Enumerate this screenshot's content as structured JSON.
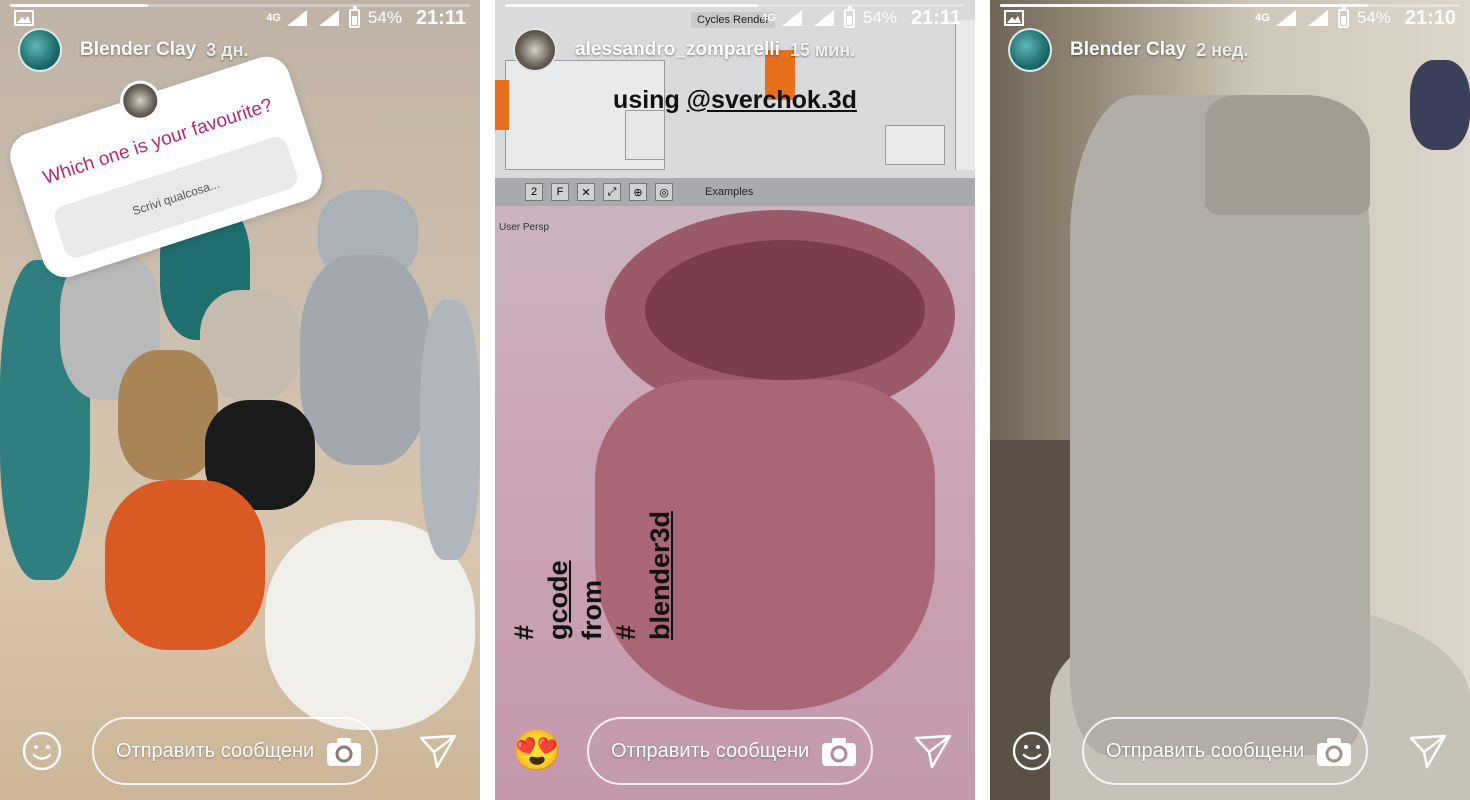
{
  "status_bar": [
    {
      "network": "4G",
      "battery": "54%",
      "time": "21:11"
    },
    {
      "network": "4G",
      "battery": "54%",
      "time": "21:11"
    },
    {
      "network": "4G",
      "battery": "54%",
      "time": "21:10"
    }
  ],
  "stories": [
    {
      "username": "Blender Clay",
      "time_ago": "3 дн.",
      "question_sticker": {
        "question": "Which one is your favourite?",
        "input_placeholder": "Scrivi qualcosa..."
      }
    },
    {
      "username": "alessandro_zomparelli",
      "time_ago": "15 мин.",
      "overlay_text_top_prefix": "using ",
      "overlay_text_top_mention": "@sverchok.3d",
      "overlay_text_vertical_line1_prefix": "#",
      "overlay_text_vertical_line1_tag": "gcode",
      "overlay_text_vertical_line1_suffix": " from",
      "overlay_text_vertical_line2_prefix": "#",
      "overlay_text_vertical_line2_tag": "blender3d",
      "app_ui": {
        "cycles_tab": "Cycles Render",
        "examples_label": "Examples",
        "layer_value": "2",
        "viewport_label": "User Persp"
      }
    },
    {
      "username": "Blender Clay",
      "time_ago": "2 нед."
    }
  ],
  "reply_bar": {
    "placeholder": "Отправить сообщени",
    "emoji": "😍"
  },
  "icons": [
    "smiley-icon",
    "camera-icon",
    "send-icon",
    "heart-eyes-emoji"
  ]
}
